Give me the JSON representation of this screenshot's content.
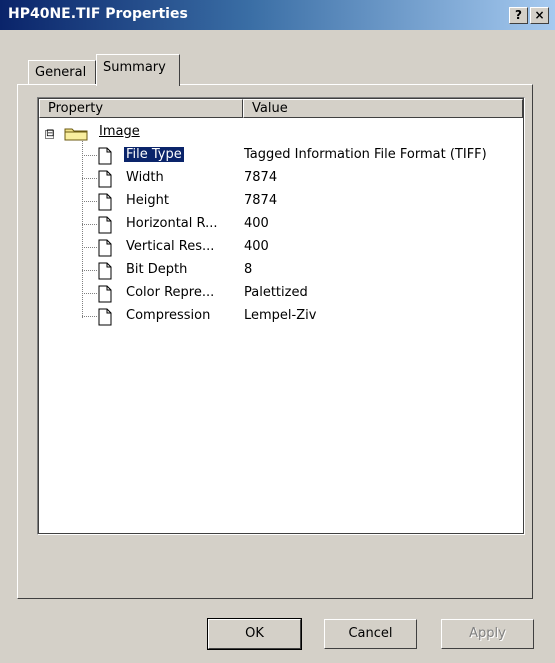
{
  "window": {
    "title": "HP40NE.TIF Properties",
    "help_label": "?",
    "close_label": "×"
  },
  "tabs": [
    {
      "label": "General"
    },
    {
      "label": "Summary"
    }
  ],
  "list": {
    "columns": [
      {
        "label": "Property"
      },
      {
        "label": "Value"
      }
    ],
    "group": {
      "label": "Image",
      "expander": "⊟"
    },
    "rows": [
      {
        "property": "File Type",
        "value": "Tagged Information File Format (TIFF)",
        "selected": true
      },
      {
        "property": "Width",
        "value": "7874"
      },
      {
        "property": "Height",
        "value": "7874"
      },
      {
        "property": "Horizontal R...",
        "value": "400"
      },
      {
        "property": "Vertical Res...",
        "value": "400"
      },
      {
        "property": "Bit Depth",
        "value": "8"
      },
      {
        "property": "Color Repre...",
        "value": "Palettized"
      },
      {
        "property": "Compression",
        "value": "Lempel-Ziv"
      }
    ]
  },
  "buttons": {
    "ok": "OK",
    "cancel": "Cancel",
    "apply": "Apply"
  },
  "icons": {
    "group": "folder-icon",
    "item": "document-icon"
  },
  "colors": {
    "title_gradient_start": "#0a246a",
    "title_gradient_end": "#a6caf0",
    "dialog_face": "#d4d0c8",
    "selection": "#0a246a"
  }
}
